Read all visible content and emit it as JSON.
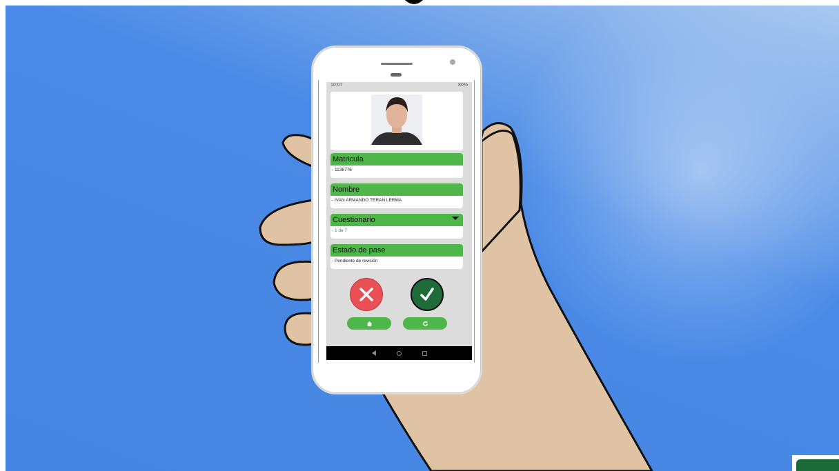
{
  "status_bar": {
    "time": "10:07",
    "battery": "80%"
  },
  "profile": {
    "photo_alt": "student photo"
  },
  "fields": [
    {
      "label": "Matricula",
      "value": "- 1136776"
    },
    {
      "label": "Nombre",
      "value": "- IVAN ARMANDO TERAN LERMA"
    },
    {
      "label": "Cuestionario",
      "value": "- 1 de 7"
    },
    {
      "label": "Estado de pase",
      "value": "- Pendiente de revisión"
    }
  ],
  "actions": {
    "reject_icon": "x-icon",
    "approve_icon": "check-icon",
    "home_icon": "home-icon",
    "refresh_icon": "refresh-icon"
  },
  "colors": {
    "accent_green": "#4fb649",
    "reject_red": "#e85055",
    "approve_green": "#1f6b3a",
    "sky_blue": "#4686e3"
  }
}
